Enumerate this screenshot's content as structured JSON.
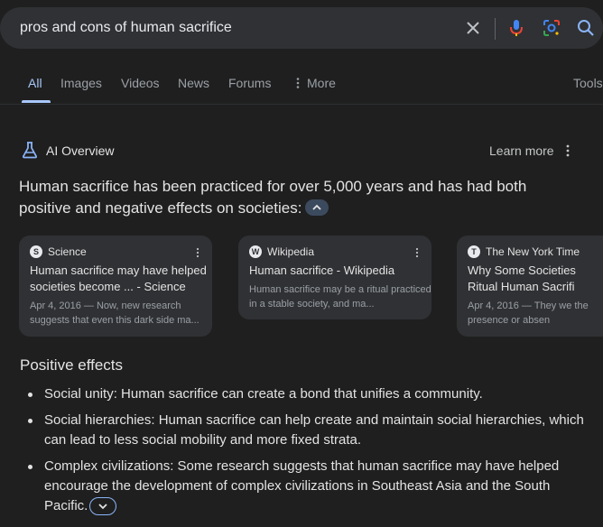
{
  "search": {
    "query": "pros and cons of human sacrifice",
    "icons": [
      "close-icon",
      "mic-icon",
      "lens-icon",
      "search-icon"
    ]
  },
  "tabs": [
    {
      "label": "All",
      "active": true
    },
    {
      "label": "Images"
    },
    {
      "label": "Videos"
    },
    {
      "label": "News"
    },
    {
      "label": "Forums"
    },
    {
      "label": "More"
    },
    {
      "label": "Tools"
    }
  ],
  "ai_overview": {
    "title": "AI Overview",
    "learn_more": "Learn more",
    "summary": "Human sacrifice has been practiced for over 5,000 years and has had both positive and negative effects on societies:",
    "sources": [
      {
        "name": "Science",
        "favicon": "S",
        "title": "Human sacrifice may have helped societies become ... - Science",
        "snippet": "Apr 4, 2016 — Now, new research suggests that even this dark side ma..."
      },
      {
        "name": "Wikipedia",
        "favicon": "W",
        "title": "Human sacrifice - Wikipedia",
        "snippet": "Human sacrifice may be a ritual practiced in a stable society, and ma..."
      },
      {
        "name": "The New York Time",
        "favicon": "T",
        "title": "Why Some Societies Ritual Human Sacrifi",
        "snippet": "Apr 4, 2016 — They we the presence or absen"
      }
    ],
    "section_heading": "Positive effects",
    "bullets": [
      "Social unity: Human sacrifice can create a bond that unifies a community.",
      "Social hierarchies: Human sacrifice can help create and maintain social hierarchies, which can lead to less social mobility and more fixed strata.",
      "Complex civilizations: Some research suggests that human sacrifice may have helped encourage the development of complex civilizations in Southeast Asia and the South Pacific."
    ]
  },
  "colors": {
    "background": "#1f1f1f",
    "searchbar": "#303134",
    "accent": "#a8c7fa",
    "card": "#303134"
  }
}
